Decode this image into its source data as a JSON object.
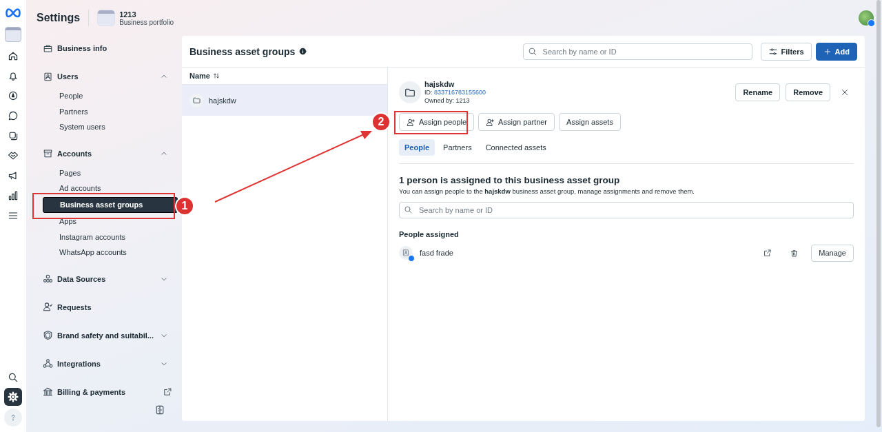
{
  "app": {
    "title": "Settings"
  },
  "portfolio": {
    "name": "1213",
    "subtitle": "Business portfolio"
  },
  "rail": {
    "items": [
      {
        "kind": "portfolio",
        "selected": false
      },
      {
        "kind": "home",
        "selected": false
      },
      {
        "kind": "bell",
        "selected": false
      },
      {
        "kind": "compass",
        "selected": false
      },
      {
        "kind": "chat",
        "selected": false
      },
      {
        "kind": "layers",
        "selected": false
      },
      {
        "kind": "handshake",
        "selected": false
      },
      {
        "kind": "megaphone",
        "selected": false
      },
      {
        "kind": "chart",
        "selected": false
      },
      {
        "kind": "menu",
        "selected": false
      }
    ],
    "bottom": [
      {
        "kind": "search",
        "selected": false
      },
      {
        "kind": "gear",
        "selected": true
      },
      {
        "kind": "help",
        "selected": false
      }
    ]
  },
  "sidebar": {
    "items": [
      {
        "label": "Business info",
        "kind": "link"
      },
      {
        "label": "Users",
        "kind": "group",
        "expanded": true,
        "children": [
          {
            "label": "People",
            "selected": false
          },
          {
            "label": "Partners",
            "selected": false
          },
          {
            "label": "System users",
            "selected": false
          }
        ]
      },
      {
        "label": "Accounts",
        "kind": "group",
        "expanded": true,
        "children": [
          {
            "label": "Pages",
            "selected": false
          },
          {
            "label": "Ad accounts",
            "selected": false
          },
          {
            "label": "Business asset groups",
            "selected": true
          },
          {
            "label": "Apps",
            "selected": false
          },
          {
            "label": "Instagram accounts",
            "selected": false
          },
          {
            "label": "WhatsApp accounts",
            "selected": false
          }
        ]
      },
      {
        "label": "Data Sources",
        "kind": "group",
        "expanded": false
      },
      {
        "label": "Requests",
        "kind": "link"
      },
      {
        "label": "Brand safety and suitabil...",
        "kind": "group",
        "expanded": false
      },
      {
        "label": "Integrations",
        "kind": "group",
        "expanded": false
      },
      {
        "label": "Billing & payments",
        "kind": "external"
      }
    ]
  },
  "page": {
    "title": "Business asset groups",
    "search": {
      "placeholder": "Search by name or ID"
    },
    "buttons": [
      {
        "label": "Filters",
        "kind": "secondary"
      },
      {
        "label": "Add",
        "kind": "primary"
      }
    ]
  },
  "list": {
    "columns": [
      {
        "label": "Name"
      }
    ],
    "rows": [
      {
        "name": "hajskdw",
        "selected": true
      }
    ]
  },
  "detail": {
    "name": "hajskdw",
    "id_label": "ID:",
    "id": "833716783155600",
    "owner": "Owned by: 1213",
    "actions": [
      "Rename",
      "Remove"
    ],
    "assign_buttons": [
      "Assign people",
      "Assign partner",
      "Assign assets"
    ],
    "tabs": [
      {
        "label": "People",
        "selected": true
      },
      {
        "label": "Partners",
        "selected": false
      },
      {
        "label": "Connected assets",
        "selected": false
      }
    ],
    "heading": "1 person is assigned to this business asset group",
    "description": "You can assign people to the **hajskdw** business asset group, manage assignments and remove them.",
    "search": {
      "placeholder": "Search by name or ID"
    },
    "section_title": "People assigned",
    "people": [
      {
        "name": "fasd frade",
        "action": "Manage"
      }
    ]
  },
  "annotations": [
    {
      "label": "1"
    },
    {
      "label": "2"
    }
  ]
}
